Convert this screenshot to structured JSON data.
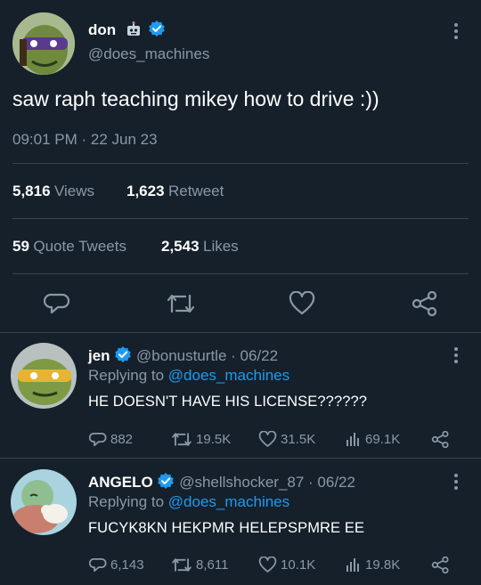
{
  "main_tweet": {
    "display_name": "don",
    "badge_icon": "robot-icon",
    "handle": "@does_machines",
    "text": "saw raph teaching mikey how to drive :))",
    "timestamp": "09:01 PM · 22 Jun 23",
    "views_count": "5,816",
    "views_label": "Views",
    "retweets_count": "1,623",
    "retweets_label": "Retweet",
    "quotes_count": "59",
    "quotes_label": "Quote Tweets",
    "likes_count": "2,543",
    "likes_label": "Likes",
    "actions": [
      "reply-icon",
      "retweet-icon",
      "like-icon",
      "share-icon"
    ]
  },
  "replies": [
    {
      "display_name": "jen",
      "handle_date": "@bonusturtle · 06/22",
      "replying_prefix": "Replying to",
      "replying_to": "@does_machines",
      "text": "HE DOESN'T HAVE HIS LICENSE??????",
      "reply_count": "882",
      "retweet_count": "19.5K",
      "like_count": "31.5K",
      "view_count": "69.1K"
    },
    {
      "display_name": "ANGELO",
      "handle_date": "@shellshocker_87 · 06/22",
      "replying_prefix": "Replying to",
      "replying_to": "@does_machines",
      "text": "FUCYK8KN HEKPMR HELEPSPMRE EE",
      "reply_count": "6,143",
      "retweet_count": "8,611",
      "like_count": "10.1K",
      "view_count": "19.8K"
    }
  ],
  "colors": {
    "background": "#15202b",
    "muted": "#8b98a5",
    "link": "#1d9bf0",
    "divider": "#38444d"
  }
}
